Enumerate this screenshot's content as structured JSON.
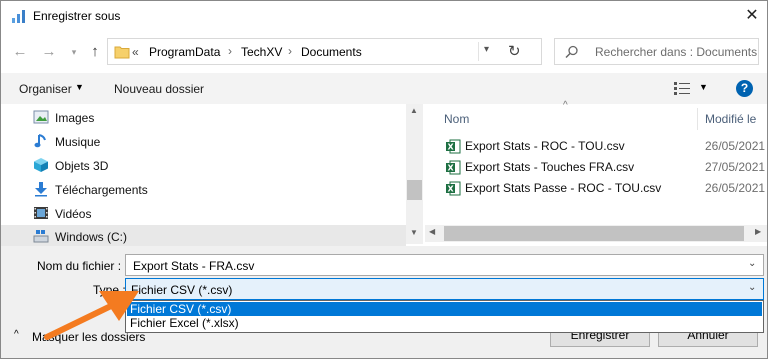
{
  "window": {
    "title": "Enregistrer sous"
  },
  "nav": {
    "back_icon": "arrow-left-icon",
    "forward_icon": "arrow-right-icon",
    "recent_icon": "chevron-down-icon",
    "up_icon": "arrow-up-icon"
  },
  "address": {
    "overflow": "«",
    "crumbs": [
      "ProgramData",
      "TechXV",
      "Documents"
    ],
    "separator": "›"
  },
  "search": {
    "placeholder": "Rechercher dans : Documents"
  },
  "toolbar": {
    "organize_label": "Organiser",
    "new_folder_label": "Nouveau dossier"
  },
  "sidebar": {
    "items": [
      {
        "label": "Images",
        "icon": "images-icon"
      },
      {
        "label": "Musique",
        "icon": "music-icon"
      },
      {
        "label": "Objets 3D",
        "icon": "cube-icon"
      },
      {
        "label": "Téléchargements",
        "icon": "download-icon"
      },
      {
        "label": "Vidéos",
        "icon": "video-icon"
      },
      {
        "label": "Windows (C:)",
        "icon": "drive-icon"
      }
    ]
  },
  "filelist": {
    "col_name": "Nom",
    "col_modified": "Modifié le",
    "files": [
      {
        "name": "Export Stats - ROC - TOU.csv",
        "date": "26/05/2021"
      },
      {
        "name": "Export Stats - Touches FRA.csv",
        "date": "27/05/2021"
      },
      {
        "name": "Export Stats Passe - ROC - TOU.csv",
        "date": "26/05/2021"
      }
    ]
  },
  "save": {
    "filename_label": "Nom du fichier :",
    "filename_value": "Export Stats - FRA.csv",
    "type_label": "Type :",
    "type_value": "Fichier CSV (*.csv)",
    "type_options": [
      "Fichier CSV (*.csv)",
      "Fichier Excel (*.xlsx)"
    ],
    "hide_folders_label": "Masquer les dossiers",
    "save_button": "Enregistrer",
    "cancel_button": "Annuler"
  },
  "colors": {
    "accent": "#0078d7",
    "arrow": "#f47b20",
    "excel_green": "#1d6f42",
    "help_blue": "#0063b1"
  }
}
